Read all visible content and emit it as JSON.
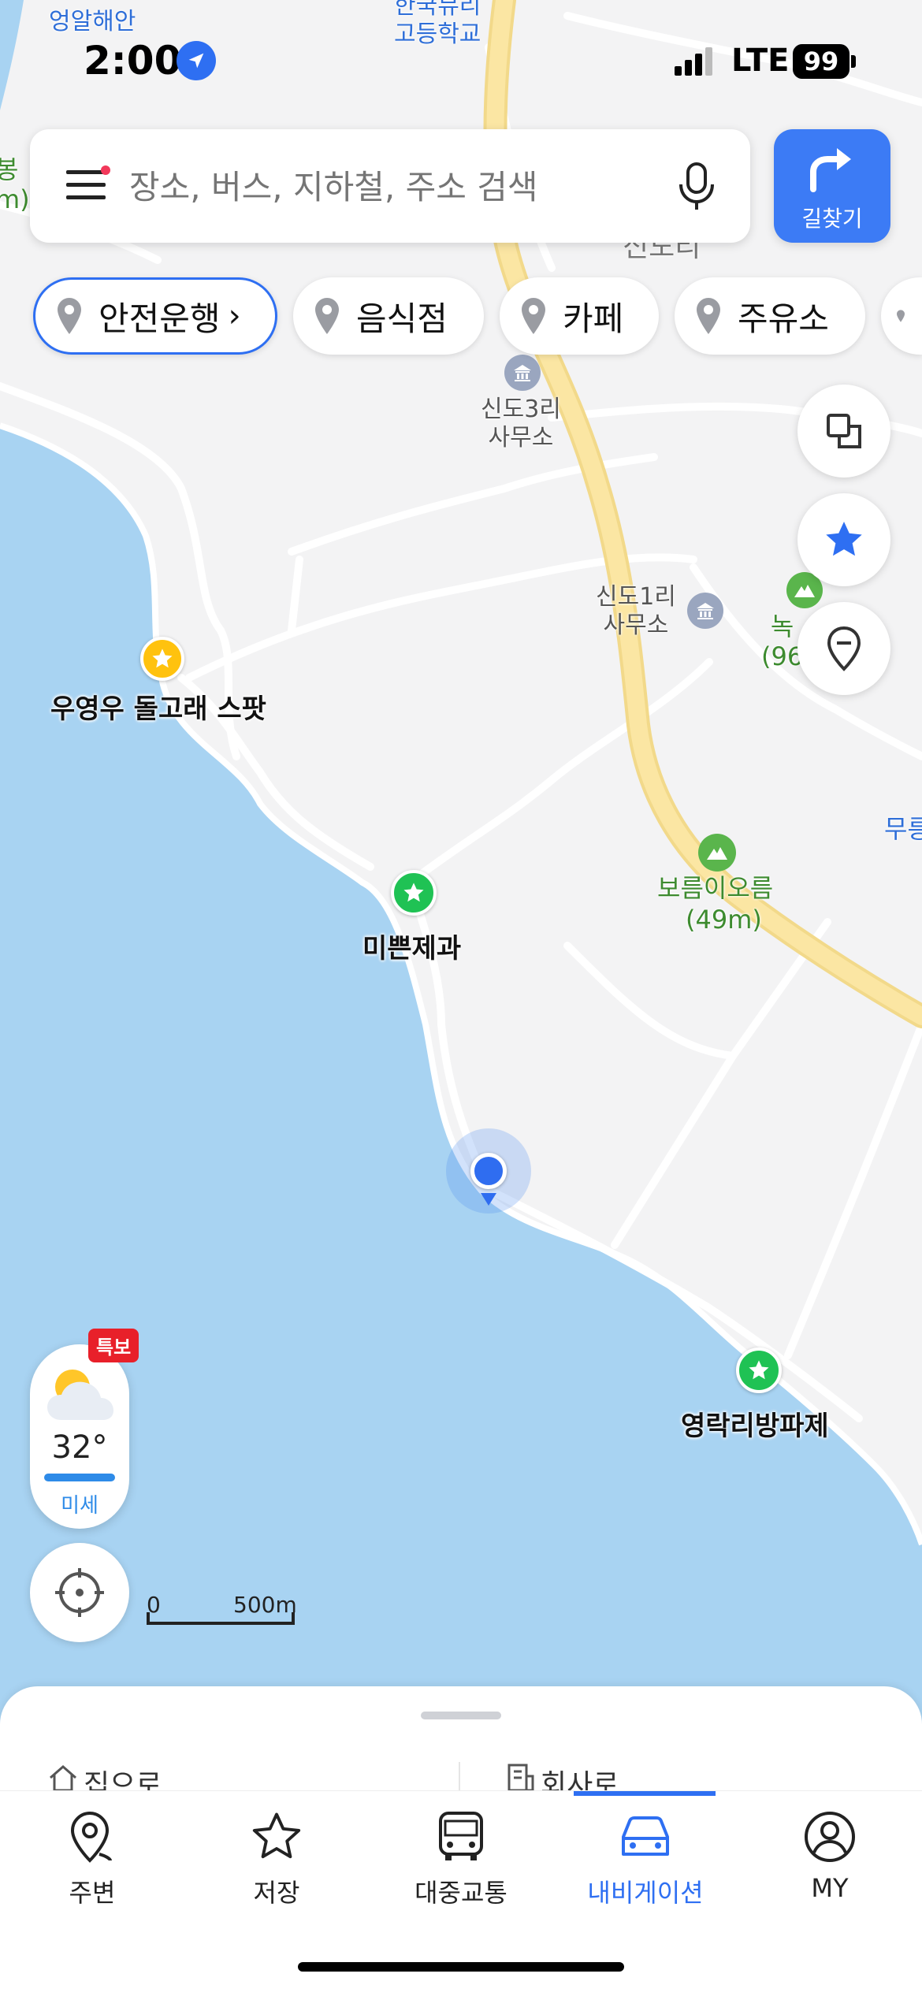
{
  "status_bar": {
    "time": "2:00",
    "network": "LTE",
    "battery": "99"
  },
  "search": {
    "placeholder": "장소, 버스, 지하철, 주소 검색"
  },
  "directions_button": {
    "label": "길찾기"
  },
  "chips": [
    {
      "label": "안전운행"
    },
    {
      "label": "음식점"
    },
    {
      "label": "카페"
    },
    {
      "label": "주유소"
    }
  ],
  "map_labels": {
    "top_left": "엉알해안",
    "top_center": "한국뮤리\n고등학교",
    "edge_left": "봉\nm)",
    "village": "신도리",
    "office3": "신도3리\n사무소",
    "office1": "신도1리\n사무소",
    "peak_partial": "녹\n(96",
    "edge_right": "무릉"
  },
  "places": {
    "whale": "우영우 돌고래 스팟",
    "bakery": "미쁜제과",
    "oreum_name": "보름이오름",
    "oreum_height": "(49m)",
    "pajeon": "영락리방파제"
  },
  "weather": {
    "badge": "특보",
    "temperature": "32°",
    "dust": "미세"
  },
  "scale": {
    "start": "0",
    "end": "500m"
  },
  "sheet": {
    "home": "집으로",
    "work": "회사로"
  },
  "bottom_nav": [
    {
      "label": "주변",
      "icon": "nearby-pin-icon"
    },
    {
      "label": "저장",
      "icon": "star-icon"
    },
    {
      "label": "대중교통",
      "icon": "bus-icon"
    },
    {
      "label": "내비게이션",
      "icon": "car-icon",
      "active": true
    },
    {
      "label": "MY",
      "icon": "profile-icon"
    }
  ],
  "colors": {
    "accent": "#2e6ff2",
    "sea": "#a8d3f2",
    "land": "#f3f3f4",
    "road": "#fae29a",
    "green_star": "#1fc254",
    "yellow_star": "#ffc20e",
    "alert": "#e8202a"
  }
}
